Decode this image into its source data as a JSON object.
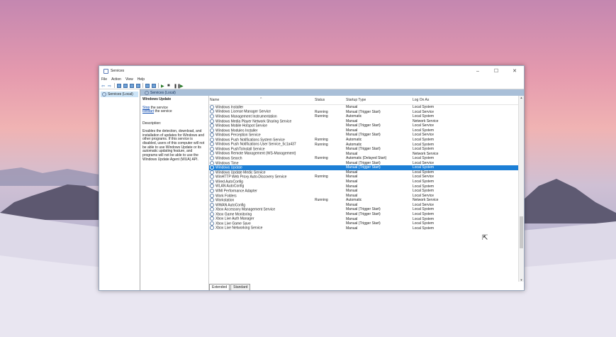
{
  "window": {
    "title": "Services",
    "controls": {
      "minimize": "–",
      "maximize": "☐",
      "close": "✕"
    }
  },
  "menu": [
    "File",
    "Action",
    "View",
    "Help"
  ],
  "tree": {
    "item": "Services (Local)"
  },
  "main_header": "Services (Local)",
  "description": {
    "service_name": "Windows Update",
    "stop_link": "Stop",
    "stop_rest": " the service",
    "restart_link": "Restart",
    "restart_rest": " the service",
    "label": "Description:",
    "text": "Enables the detection, download, and installation of updates for Windows and other programs. If this service is disabled, users of this computer will not be able to use Windows Update or its automatic updating feature, and programs will not be able to use the Windows Update Agent (WUA) API."
  },
  "columns": {
    "name": "Name",
    "status": "Status",
    "startup": "Startup Type",
    "logon": "Log On As"
  },
  "services": [
    {
      "name": "Windows Installer",
      "status": "",
      "startup": "Manual",
      "logon": "Local System"
    },
    {
      "name": "Windows License Manager Service",
      "status": "Running",
      "startup": "Manual (Trigger Start)",
      "logon": "Local Service"
    },
    {
      "name": "Windows Management Instrumentation",
      "status": "Running",
      "startup": "Automatic",
      "logon": "Local System"
    },
    {
      "name": "Windows Media Player Network Sharing Service",
      "status": "",
      "startup": "Manual",
      "logon": "Network Service"
    },
    {
      "name": "Windows Mobile Hotspot Service",
      "status": "",
      "startup": "Manual (Trigger Start)",
      "logon": "Local Service"
    },
    {
      "name": "Windows Modules Installer",
      "status": "",
      "startup": "Manual",
      "logon": "Local System"
    },
    {
      "name": "Windows Perception Service",
      "status": "",
      "startup": "Manual (Trigger Start)",
      "logon": "Local Service"
    },
    {
      "name": "Windows Push Notifications System Service",
      "status": "Running",
      "startup": "Automatic",
      "logon": "Local System"
    },
    {
      "name": "Windows Push Notifications User Service_5c1a437",
      "status": "Running",
      "startup": "Automatic",
      "logon": "Local System"
    },
    {
      "name": "Windows PushToInstall Service",
      "status": "",
      "startup": "Manual (Trigger Start)",
      "logon": "Local System"
    },
    {
      "name": "Windows Remote Management (WS-Management)",
      "status": "",
      "startup": "Manual",
      "logon": "Network Service"
    },
    {
      "name": "Windows Search",
      "status": "Running",
      "startup": "Automatic (Delayed Start)",
      "logon": "Local System"
    },
    {
      "name": "Windows Time",
      "status": "",
      "startup": "Manual (Trigger Start)",
      "logon": "Local Service"
    },
    {
      "name": "Windows Update",
      "status": "",
      "startup": "Manual (Trigger Start)",
      "logon": "Local System",
      "selected": true
    },
    {
      "name": "Windows Update Medic Service",
      "status": "",
      "startup": "Manual",
      "logon": "Local System"
    },
    {
      "name": "WinHTTP Web Proxy Auto-Discovery Service",
      "status": "Running",
      "startup": "Manual",
      "logon": "Local Service"
    },
    {
      "name": "Wired AutoConfig",
      "status": "",
      "startup": "Manual",
      "logon": "Local System"
    },
    {
      "name": "WLAN AutoConfig",
      "status": "",
      "startup": "Manual",
      "logon": "Local System"
    },
    {
      "name": "WMI Performance Adapter",
      "status": "",
      "startup": "Manual",
      "logon": "Local System"
    },
    {
      "name": "Work Folders",
      "status": "",
      "startup": "Manual",
      "logon": "Local Service"
    },
    {
      "name": "Workstation",
      "status": "Running",
      "startup": "Automatic",
      "logon": "Network Service"
    },
    {
      "name": "WWAN AutoConfig",
      "status": "",
      "startup": "Manual",
      "logon": "Local Service"
    },
    {
      "name": "Xbox Accessory Management Service",
      "status": "",
      "startup": "Manual (Trigger Start)",
      "logon": "Local System"
    },
    {
      "name": "Xbox Game Monitoring",
      "status": "",
      "startup": "Manual (Trigger Start)",
      "logon": "Local System"
    },
    {
      "name": "Xbox Live Auth Manager",
      "status": "",
      "startup": "Manual",
      "logon": "Local System"
    },
    {
      "name": "Xbox Live Game Save",
      "status": "",
      "startup": "Manual (Trigger Start)",
      "logon": "Local System"
    },
    {
      "name": "Xbox Live Networking Service",
      "status": "",
      "startup": "Manual",
      "logon": "Local System"
    }
  ],
  "tabs": {
    "extended": "Extended",
    "standard": "Standard"
  },
  "accent": "#1c7fd6",
  "header_color": "#a9bfd8"
}
